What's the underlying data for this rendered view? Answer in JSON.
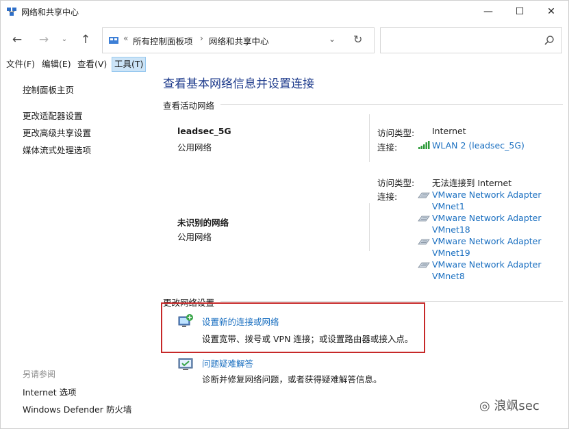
{
  "window": {
    "title": "网络和共享中心",
    "controls": {
      "minimize": "—",
      "maximize": "☐",
      "close": "✕"
    }
  },
  "navigation": {
    "back": "←",
    "forward": "→",
    "history": "⌄",
    "up": "↑",
    "address": {
      "prefix": "«",
      "crumbs": [
        "所有控制面板项",
        "网络和共享中心"
      ],
      "separator": "›",
      "dropdown": "⌄",
      "refresh": "↻"
    },
    "search": {
      "value": "",
      "placeholder": ""
    }
  },
  "menu": {
    "file": "文件(F)",
    "edit": "编辑(E)",
    "view": "查看(V)",
    "tools": "工具(T)"
  },
  "sidebar": {
    "links": [
      "控制面板主页",
      "更改适配器设置",
      "更改高级共享设置",
      "媒体流式处理选项"
    ],
    "see_also_title": "另请参阅",
    "see_also": [
      "Internet 选项",
      "Windows Defender 防火墙"
    ]
  },
  "main": {
    "title": "查看基本网络信息并设置连接",
    "active_networks_heading": "查看活动网络",
    "networks": [
      {
        "name": "leadsec_5G",
        "type": "公用网络",
        "access_label": "访问类型:",
        "access_value": "Internet",
        "connection_label": "连接:",
        "connections": [
          {
            "text": "WLAN 2 (leadsec_5G)",
            "icon": "wifi-signal-icon"
          }
        ]
      },
      {
        "name": "未识别的网络",
        "type": "公用网络",
        "access_label": "访问类型:",
        "access_value": "无法连接到 Internet",
        "connection_label": "连接:",
        "connections": [
          {
            "line1": "VMware Network Adapter",
            "line2": "VMnet1",
            "icon": "ethernet-adapter-icon"
          },
          {
            "line1": "VMware Network Adapter",
            "line2": "VMnet18",
            "icon": "ethernet-adapter-icon"
          },
          {
            "line1": "VMware Network Adapter",
            "line2": "VMnet19",
            "icon": "ethernet-adapter-icon"
          },
          {
            "line1": "VMware Network Adapter",
            "line2": "VMnet8",
            "icon": "ethernet-adapter-icon"
          }
        ]
      }
    ],
    "change_settings_heading": "更改网络设置",
    "tasks": [
      {
        "link": "设置新的连接或网络",
        "desc": "设置宽带、拨号或 VPN 连接；或设置路由器或接入点。",
        "icon": "new-connection-icon"
      },
      {
        "link": "问题疑难解答",
        "desc": "诊断并修复网络问题，或者获得疑难解答信息。",
        "icon": "troubleshoot-icon"
      }
    ]
  },
  "watermark": {
    "text": "浪飒sec"
  },
  "colors": {
    "link": "#1a6fc0",
    "title": "#1e3b8c",
    "highlight": "#c62828",
    "menu_active": "#cce4f7"
  }
}
